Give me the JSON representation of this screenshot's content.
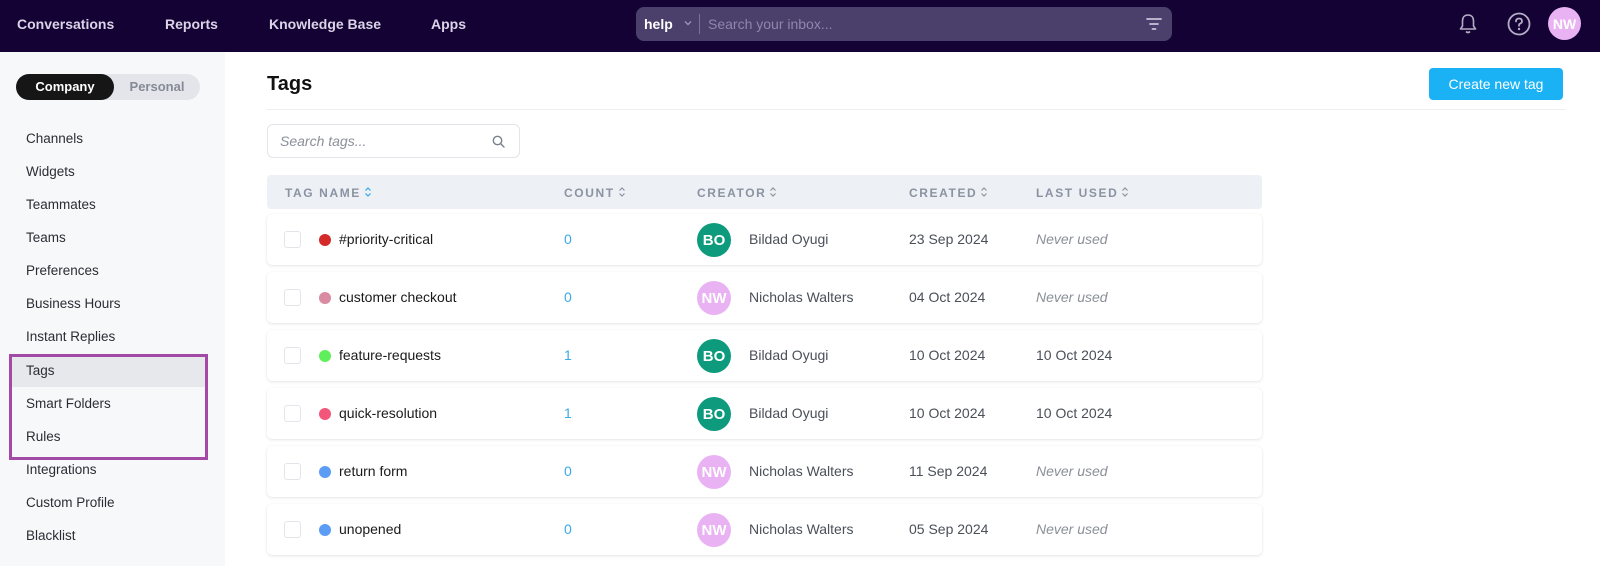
{
  "topbar": {
    "nav": [
      "Conversations",
      "Reports",
      "Knowledge Base",
      "Apps"
    ],
    "search": {
      "scope": "help",
      "placeholder": "Search your inbox..."
    },
    "icons": {
      "notifications": "bell-icon",
      "help": "help-circle-icon",
      "filter": "filter-icon"
    },
    "user_initials": "NW"
  },
  "sidebar": {
    "segments": [
      "Company",
      "Personal"
    ],
    "active_segment": "Company",
    "items": [
      {
        "label": "Channels"
      },
      {
        "label": "Widgets"
      },
      {
        "label": "Teammates"
      },
      {
        "label": "Teams"
      },
      {
        "label": "Preferences"
      },
      {
        "label": "Business Hours"
      },
      {
        "label": "Instant Replies"
      },
      {
        "label": "Tags",
        "active": true
      },
      {
        "label": "Smart Folders"
      },
      {
        "label": "Rules"
      },
      {
        "label": "Integrations"
      },
      {
        "label": "Custom Profile"
      },
      {
        "label": "Blacklist"
      }
    ],
    "highlight_color": "#a24aa6"
  },
  "main": {
    "title": "Tags",
    "create_button": "Create new tag",
    "search_placeholder": "Search tags...",
    "columns": [
      "TAG NAME",
      "COUNT",
      "CREATOR",
      "CREATED",
      "LAST USED"
    ],
    "rows": [
      {
        "color": "#d42a2a",
        "name": "#priority-critical",
        "count": "0",
        "initials": "BO",
        "avatar_color": "#0e9a7c",
        "creator": "Bildad Oyugi",
        "created": "23 Sep 2024",
        "last_used": "Never used",
        "never": true
      },
      {
        "color": "#d98ba2",
        "name": "customer checkout",
        "count": "0",
        "initials": "NW",
        "avatar_color": "#e9b3f3",
        "creator": "Nicholas Walters",
        "created": "04 Oct 2024",
        "last_used": "Never used",
        "never": true
      },
      {
        "color": "#5fef5a",
        "name": "feature-requests",
        "count": "1",
        "initials": "BO",
        "avatar_color": "#0e9a7c",
        "creator": "Bildad Oyugi",
        "created": "10 Oct 2024",
        "last_used": "10 Oct 2024",
        "never": false
      },
      {
        "color": "#f2567a",
        "name": "quick-resolution",
        "count": "1",
        "initials": "BO",
        "avatar_color": "#0e9a7c",
        "creator": "Bildad Oyugi",
        "created": "10 Oct 2024",
        "last_used": "10 Oct 2024",
        "never": false
      },
      {
        "color": "#5b9df5",
        "name": "return form",
        "count": "0",
        "initials": "NW",
        "avatar_color": "#e9b3f3",
        "creator": "Nicholas Walters",
        "created": "11 Sep 2024",
        "last_used": "Never used",
        "never": true
      },
      {
        "color": "#5b9df5",
        "name": "unopened",
        "count": "0",
        "initials": "NW",
        "avatar_color": "#e9b3f3",
        "creator": "Nicholas Walters",
        "created": "05 Sep 2024",
        "last_used": "Never used",
        "never": true
      }
    ]
  },
  "colors": {
    "topbar": "#150235",
    "accent": "#1ab2f5",
    "count_link": "#3aa9e6"
  }
}
